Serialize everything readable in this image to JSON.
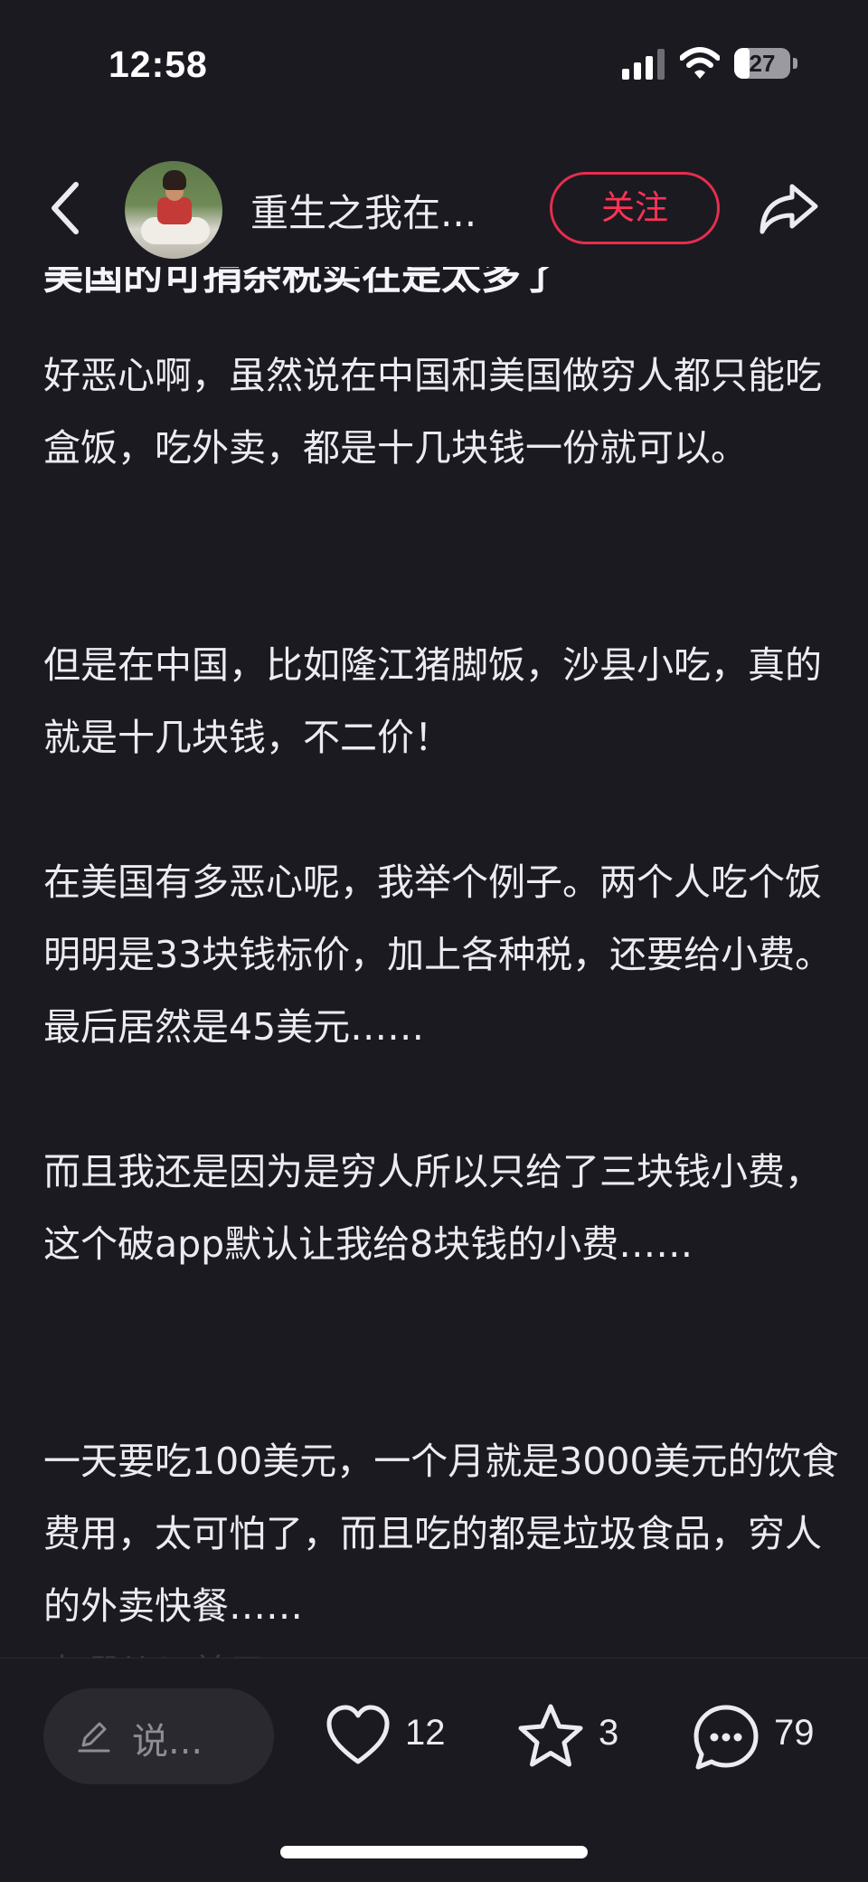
{
  "status_bar": {
    "time": "12:58",
    "battery": "27",
    "battery_level": 0.27
  },
  "nav": {
    "nickname": "重生之我在...",
    "follow_label": "关注"
  },
  "post": {
    "title": "美国的可捐杂税实在是太多了",
    "paragraphs": [
      "好恶心啊，虽然说在中国和美国做穷人都只能吃盒饭，吃外卖，都是十几块钱一份就可以。",
      "但是在中国，比如隆江猪脚饭，沙县小吃，真的就是十几块钱，不二价！",
      "在美国有多恶心呢，我举个例子。两个人吃个饭明明是33块钱标价，加上各种税，还要给小费。最后居然是45美元……",
      "而且我还是因为是穷人所以只给了三块钱小费，这个破app默认让我给8块钱的小费……",
      "一天要吃100美元，一个月就是3000美元的饮食费用，太可怕了，而且吃的都是垃圾食品，穷人的外卖快餐……"
    ],
    "cut_off_line": "去哪儿？美元"
  },
  "bottom_bar": {
    "comment_placeholder": "说...",
    "likes": "12",
    "favorites": "3",
    "comments": "79"
  },
  "colors": {
    "background": "#1b1a21",
    "accent": "#ff3355",
    "text": "#ecebf0"
  },
  "icons": [
    "back-icon",
    "share-icon",
    "pen-icon",
    "heart-icon",
    "star-icon",
    "comment-icon",
    "signal-icon",
    "wifi-icon",
    "battery-icon"
  ]
}
